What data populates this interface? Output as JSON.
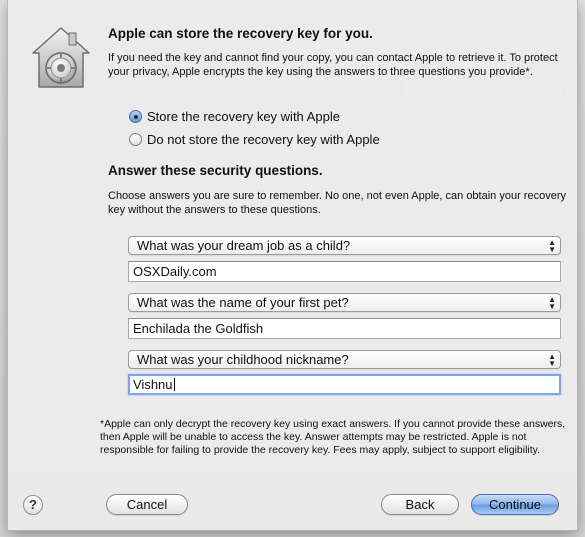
{
  "dialog": {
    "title": "Apple can store the recovery key for you.",
    "intro": "If you need the key and cannot find your copy, you can contact Apple to retrieve it. To protect your privacy, Apple encrypts the key using the answers to three questions you provide*.",
    "options": {
      "store_label": "Store the recovery key with Apple",
      "store_selected": true,
      "dont_store_label": "Do not store the recovery key with Apple",
      "dont_store_selected": false
    },
    "questions_title": "Answer these security questions.",
    "questions_intro": "Choose answers you are sure to remember. No one, not even Apple, can obtain your recovery key without the answers to these questions.",
    "questions": [
      {
        "question": "What was your dream job as a child?",
        "answer": "OSXDaily.com"
      },
      {
        "question": "What was the name of your first pet?",
        "answer": "Enchilada the Goldfish"
      },
      {
        "question": "What was your childhood nickname?",
        "answer": "Vishnu"
      }
    ],
    "footnote": "*Apple can only decrypt the recovery key using exact answers. If you cannot provide these answers, then Apple will be unable to access the key. Answer attempts may be restricted. Apple is not responsible for failing to provide the recovery key. Fees may apply, subject to support eligibility.",
    "buttons": {
      "help": "?",
      "cancel": "Cancel",
      "back": "Back",
      "continue": "Continue"
    },
    "accent_color": "#6c9de0",
    "icon": "filevault-house-icon"
  }
}
